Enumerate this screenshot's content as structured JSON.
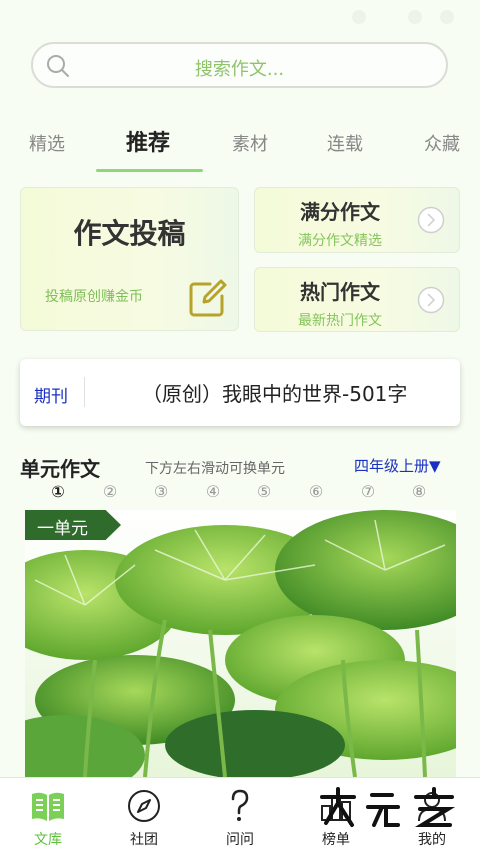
{
  "search": {
    "placeholder": "搜索作文..."
  },
  "tabs": [
    {
      "label": "精选"
    },
    {
      "label": "推荐"
    },
    {
      "label": "素材"
    },
    {
      "label": "连载"
    },
    {
      "label": "众藏"
    }
  ],
  "cards": {
    "submit": {
      "title": "作文投稿",
      "subtitle": "投稿原创赚金币"
    },
    "fullscore": {
      "title": "满分作文",
      "subtitle": "满分作文精选"
    },
    "popular": {
      "title": "热门作文",
      "subtitle": "最新热门作文"
    }
  },
  "periodical": {
    "tag": "期刊",
    "headline": "（原创）我眼中的世界-501字"
  },
  "units_section": {
    "title": "单元作文",
    "hint": "下方左右滑动可换单元",
    "grade": "四年级上册▼",
    "units": [
      "①",
      "②",
      "③",
      "④",
      "⑤",
      "⑥",
      "⑦",
      "⑧"
    ],
    "banner_label": "一单元"
  },
  "bottom_nav": [
    {
      "label": "文库",
      "icon": "book-icon"
    },
    {
      "label": "社团",
      "icon": "compass-icon"
    },
    {
      "label": "问问",
      "icon": "question-icon"
    },
    {
      "label": "榜单",
      "icon": "ranking-icon"
    },
    {
      "label": "我的",
      "icon": "profile-icon"
    }
  ],
  "colors": {
    "accent_green": "#8fd77a",
    "active_nav": "#5fbf3f",
    "link_blue": "#1b2fc2"
  }
}
